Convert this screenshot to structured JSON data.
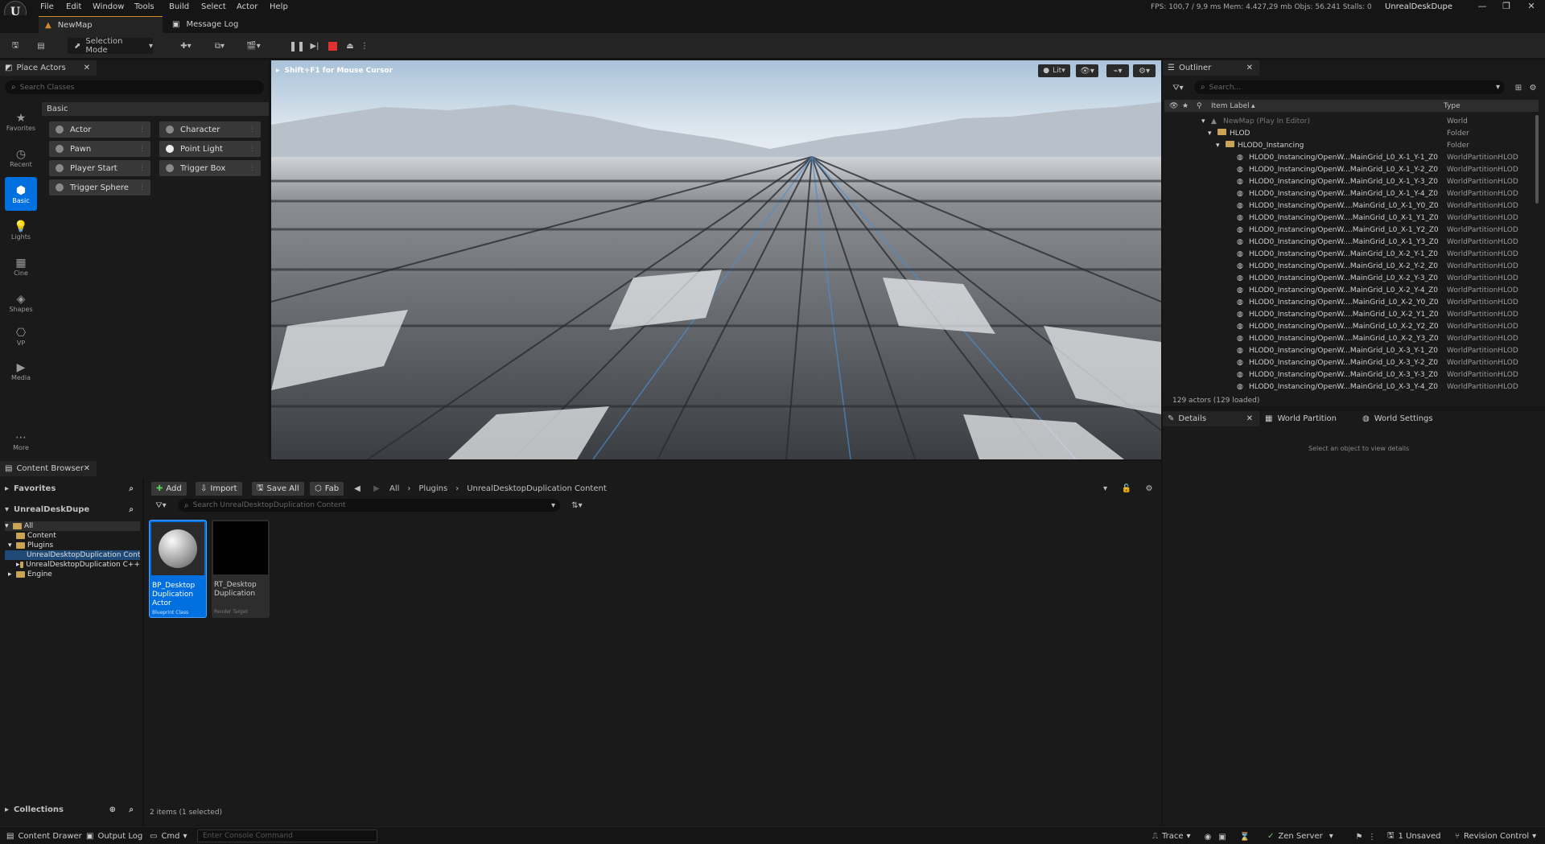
{
  "app": {
    "menu": [
      "File",
      "Edit",
      "Window",
      "Tools",
      "Build",
      "Select",
      "Actor",
      "Help"
    ],
    "stats": "FPS: 100,7 / 9,9 ms  Mem: 4.427,29 mb  Objs: 56.241  Stalls: 0",
    "project_name": "UnrealDeskDupe",
    "window_controls": [
      "—",
      "❐",
      "✕"
    ]
  },
  "tabs": {
    "map_tab": "NewMap",
    "log_tab": "Message Log"
  },
  "toolbar": {
    "selection_mode": "Selection Mode"
  },
  "place_actors": {
    "title": "Place Actors",
    "search_placeholder": "Search Classes",
    "category_header": "Basic",
    "sidebar": [
      "Favorites",
      "Recent",
      "Basic",
      "Lights",
      "Cine",
      "Shapes",
      "VP",
      "Media",
      "More"
    ],
    "actors": [
      "Actor",
      "Character",
      "Pawn",
      "Point Light",
      "Player Start",
      "Trigger Box",
      "Trigger Sphere"
    ]
  },
  "viewport": {
    "hint": "Shift+F1 for Mouse Cursor",
    "lit_label": "Lit"
  },
  "outliner": {
    "title": "Outliner",
    "search_placeholder": "Search...",
    "col_label": "Item Label",
    "col_type": "Type",
    "rows": [
      {
        "label": "NewMap (Play In Editor)",
        "type": "World"
      },
      {
        "label": "HLOD",
        "type": "Folder"
      },
      {
        "label": "HLOD0_Instancing",
        "type": "Folder"
      },
      {
        "label": "HLOD0_Instancing/OpenW...MainGrid_L0_X-1_Y-1_Z0",
        "type": "WorldPartitionHLOD"
      },
      {
        "label": "HLOD0_Instancing/OpenW...MainGrid_L0_X-1_Y-2_Z0",
        "type": "WorldPartitionHLOD"
      },
      {
        "label": "HLOD0_Instancing/OpenW...MainGrid_L0_X-1_Y-3_Z0",
        "type": "WorldPartitionHLOD"
      },
      {
        "label": "HLOD0_Instancing/OpenW...MainGrid_L0_X-1_Y-4_Z0",
        "type": "WorldPartitionHLOD"
      },
      {
        "label": "HLOD0_Instancing/OpenW....MainGrid_L0_X-1_Y0_Z0",
        "type": "WorldPartitionHLOD"
      },
      {
        "label": "HLOD0_Instancing/OpenW....MainGrid_L0_X-1_Y1_Z0",
        "type": "WorldPartitionHLOD"
      },
      {
        "label": "HLOD0_Instancing/OpenW....MainGrid_L0_X-1_Y2_Z0",
        "type": "WorldPartitionHLOD"
      },
      {
        "label": "HLOD0_Instancing/OpenW....MainGrid_L0_X-1_Y3_Z0",
        "type": "WorldPartitionHLOD"
      },
      {
        "label": "HLOD0_Instancing/OpenW...MainGrid_L0_X-2_Y-1_Z0",
        "type": "WorldPartitionHLOD"
      },
      {
        "label": "HLOD0_Instancing/OpenW...MainGrid_L0_X-2_Y-2_Z0",
        "type": "WorldPartitionHLOD"
      },
      {
        "label": "HLOD0_Instancing/OpenW...MainGrid_L0_X-2_Y-3_Z0",
        "type": "WorldPartitionHLOD"
      },
      {
        "label": "HLOD0_Instancing/OpenW...MainGrid_L0_X-2_Y-4_Z0",
        "type": "WorldPartitionHLOD"
      },
      {
        "label": "HLOD0_Instancing/OpenW....MainGrid_L0_X-2_Y0_Z0",
        "type": "WorldPartitionHLOD"
      },
      {
        "label": "HLOD0_Instancing/OpenW....MainGrid_L0_X-2_Y1_Z0",
        "type": "WorldPartitionHLOD"
      },
      {
        "label": "HLOD0_Instancing/OpenW....MainGrid_L0_X-2_Y2_Z0",
        "type": "WorldPartitionHLOD"
      },
      {
        "label": "HLOD0_Instancing/OpenW....MainGrid_L0_X-2_Y3_Z0",
        "type": "WorldPartitionHLOD"
      },
      {
        "label": "HLOD0_Instancing/OpenW...MainGrid_L0_X-3_Y-1_Z0",
        "type": "WorldPartitionHLOD"
      },
      {
        "label": "HLOD0_Instancing/OpenW...MainGrid_L0_X-3_Y-2_Z0",
        "type": "WorldPartitionHLOD"
      },
      {
        "label": "HLOD0_Instancing/OpenW...MainGrid_L0_X-3_Y-3_Z0",
        "type": "WorldPartitionHLOD"
      },
      {
        "label": "HLOD0_Instancing/OpenW...MainGrid_L0_X-3_Y-4_Z0",
        "type": "WorldPartitionHLOD"
      }
    ],
    "footer": "129 actors (129 loaded)"
  },
  "details": {
    "tab_details": "Details",
    "tab_world_partition": "World Partition",
    "tab_world_settings": "World Settings",
    "empty_msg": "Select an object to view details"
  },
  "content_browser": {
    "title": "Content Browser",
    "favorites": "Favorites",
    "project": "UnrealDeskDupe",
    "add": "Add",
    "import": "Import",
    "save_all": "Save All",
    "fab": "Fab",
    "breadcrumb": [
      "All",
      "Plugins",
      "UnrealDesktopDuplication Content"
    ],
    "search_placeholder": "Search UnrealDesktopDuplication Content",
    "tree": [
      "All",
      "Content",
      "Plugins",
      "UnrealDesktopDuplication Content",
      "UnrealDesktopDuplication C++",
      "Engine"
    ],
    "assets": [
      {
        "name": "BP_Desktop Duplication Actor",
        "type": "Blueprint Class"
      },
      {
        "name": "RT_Desktop Duplication",
        "type": "Render Target"
      }
    ],
    "collections": "Collections",
    "item_count": "2 items (1 selected)"
  },
  "status": {
    "content_drawer": "Content Drawer",
    "output_log": "Output Log",
    "cmd": "Cmd",
    "console_placeholder": "Enter Console Command",
    "trace": "Trace",
    "zen": "Zen Server",
    "unsaved": "1 Unsaved",
    "revision": "Revision Control"
  },
  "colors": {
    "accent": "#0070e0",
    "stop": "#e03030",
    "folder": "#c9a454"
  }
}
